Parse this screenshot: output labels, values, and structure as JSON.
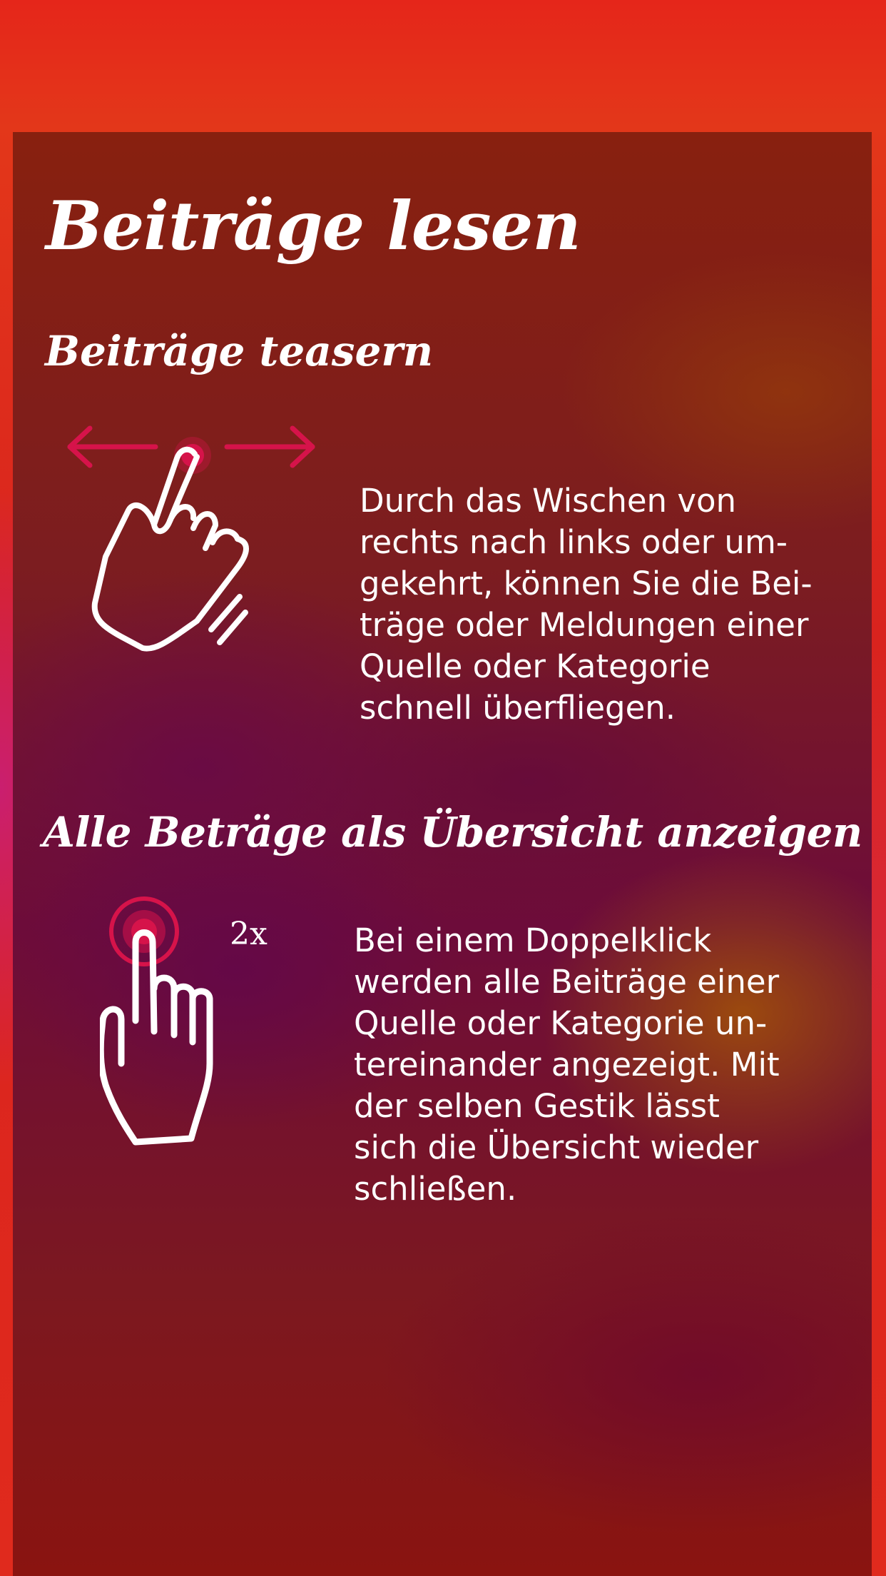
{
  "page": {
    "title": "Beiträge lesen"
  },
  "section_teaser": {
    "heading": "Beiträge teasern",
    "gesture_icon": "swipe-hand-icon",
    "lines": [
      "Durch das Wischen von",
      "rechts nach links oder um-",
      "gekehrt, können Sie die Bei-",
      "träge oder Meldungen einer",
      "Quelle oder Kategorie",
      "schnell überfliegen."
    ]
  },
  "section_overview": {
    "heading": "Alle Beträge als Übersicht anzeigen",
    "gesture_icon": "double-tap-hand-icon",
    "tap_count_label": "2x",
    "lines": [
      "Bei einem Doppelklick",
      "werden alle Beiträge einer",
      "Quelle oder Kategorie un-",
      "tereinander angezeigt. Mit",
      "der selben Gestik lässt",
      "sich die Übersicht wieder",
      "schließen."
    ]
  },
  "colors": {
    "accent": "#d6134a",
    "text": "#ffffff",
    "background_top": "#e5261a",
    "panel": "#6d0c3a"
  }
}
